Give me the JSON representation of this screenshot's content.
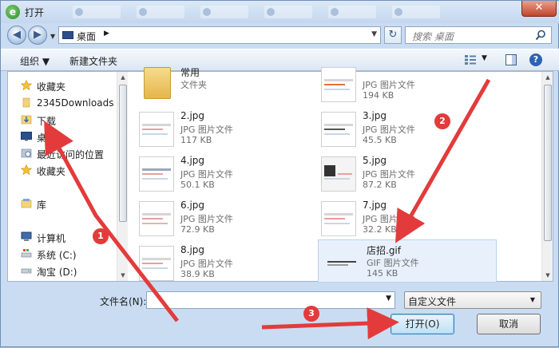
{
  "titlebar": {
    "title": "打开",
    "app_icon": "e"
  },
  "address": {
    "location": "桌面",
    "search_placeholder": "搜索 桌面"
  },
  "toolbar": {
    "organize": "组织 ▼",
    "new_folder": "新建文件夹",
    "help": "?"
  },
  "nav": {
    "items": [
      {
        "label": "收藏夹",
        "icon": "star-icon"
      },
      {
        "label": "2345Downloads",
        "icon": "folder-icon"
      },
      {
        "label": "下载",
        "icon": "download-folder-icon"
      },
      {
        "label": "桌面",
        "icon": "desktop-icon"
      },
      {
        "label": "最近访问的位置",
        "icon": "recent-places-icon"
      },
      {
        "label": "收藏夹",
        "icon": "star-icon"
      },
      {
        "label": "库",
        "icon": "library-icon"
      },
      {
        "label": "计算机",
        "icon": "computer-icon"
      },
      {
        "label": "系统 (C:)",
        "icon": "system-drive-icon"
      },
      {
        "label": "淘宝 (D:)",
        "icon": "drive-icon"
      }
    ]
  },
  "files": [
    {
      "name": "常用",
      "type": "文件夹",
      "size": ""
    },
    {
      "name": "",
      "type": "JPG 图片文件",
      "size": "194 KB"
    },
    {
      "name": "2.jpg",
      "type": "JPG 图片文件",
      "size": "117 KB"
    },
    {
      "name": "3.jpg",
      "type": "JPG 图片文件",
      "size": "45.5 KB"
    },
    {
      "name": "4.jpg",
      "type": "JPG 图片文件",
      "size": "50.1 KB"
    },
    {
      "name": "5.jpg",
      "type": "JPG 图片文件",
      "size": "87.2 KB"
    },
    {
      "name": "6.jpg",
      "type": "JPG 图片文件",
      "size": "72.9 KB"
    },
    {
      "name": "7.jpg",
      "type": "JPG 图片文件",
      "size": "32.2 KB"
    },
    {
      "name": "8.jpg",
      "type": "JPG 图片文件",
      "size": "38.9 KB"
    },
    {
      "name": "店招.gif",
      "type": "GIF 图片文件",
      "size": "145 KB"
    }
  ],
  "bottom": {
    "filename_label": "文件名(N):",
    "filename_value": "",
    "filter": "自定义文件",
    "open_button": "打开(O)",
    "cancel_button": "取消"
  },
  "annotations": {
    "badge1": "1",
    "badge2": "2",
    "badge3": "3",
    "color": "#e33b3b"
  }
}
